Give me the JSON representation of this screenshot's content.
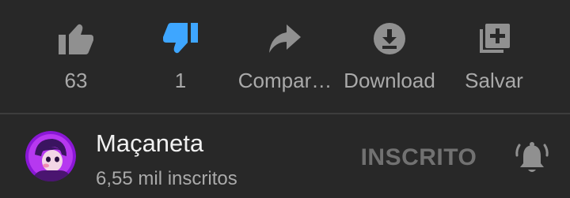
{
  "actions": {
    "like": {
      "label": "63",
      "icon": "thumb-up-icon"
    },
    "dislike": {
      "label": "1",
      "icon": "thumb-down-filled-icon",
      "active_color": "#3ea6ff"
    },
    "share": {
      "label": "Compar…",
      "icon": "share-arrow-icon"
    },
    "download": {
      "label": "Download",
      "icon": "download-icon"
    },
    "save": {
      "label": "Salvar",
      "icon": "playlist-add-icon"
    }
  },
  "channel": {
    "name": "Maçaneta",
    "subscribers": "6,55 mil inscritos",
    "avatar": "channel-avatar",
    "subscribe_label": "INSCRITO",
    "bell_icon": "notification-bell-icon"
  },
  "colors": {
    "background": "#282828",
    "primary_text": "#f1f1f1",
    "secondary_text": "#aaaaaa",
    "icon": "#909090",
    "accent": "#3ea6ff"
  }
}
